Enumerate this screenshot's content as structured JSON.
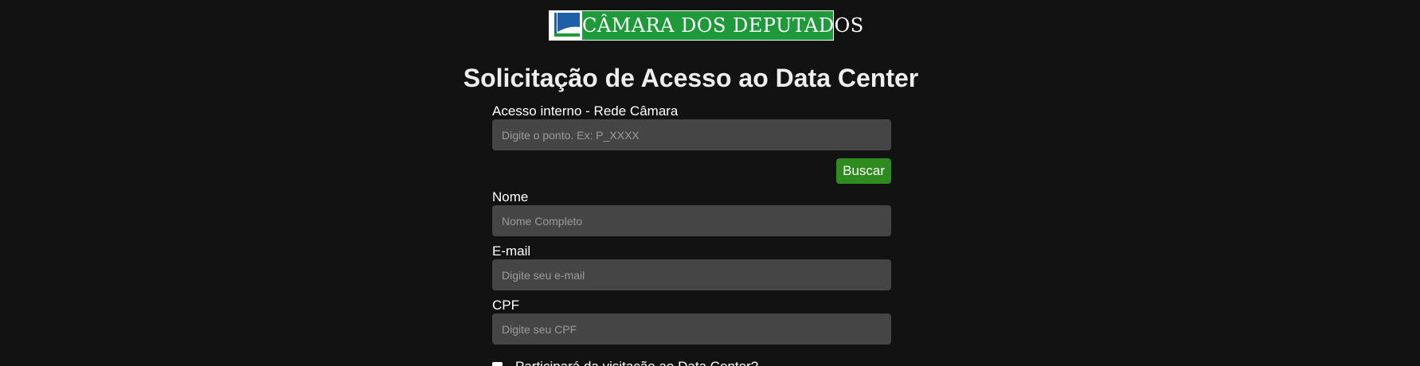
{
  "logo": {
    "text": "CÂMARA DOS DEPUTADOS"
  },
  "page_title": "Solicitação de Acesso ao Data Center",
  "form": {
    "internal_access": {
      "label": "Acesso interno - Rede Câmara",
      "placeholder": "Digite o ponto. Ex: P_XXXX",
      "value": ""
    },
    "search_button_label": "Buscar",
    "name": {
      "label": "Nome",
      "placeholder": "Nome Completo",
      "value": ""
    },
    "email": {
      "label": "E-mail",
      "placeholder": "Digite seu e-mail",
      "value": ""
    },
    "cpf": {
      "label": "CPF",
      "placeholder": "Digite seu CPF",
      "value": ""
    },
    "visit_checkbox": {
      "label": "Participará da visitação ao Data Center?",
      "checked": false
    }
  },
  "colors": {
    "background": "#121212",
    "input_background": "#454545",
    "button_green": "#2e8b1e",
    "logo_green": "#1f9a3b"
  }
}
